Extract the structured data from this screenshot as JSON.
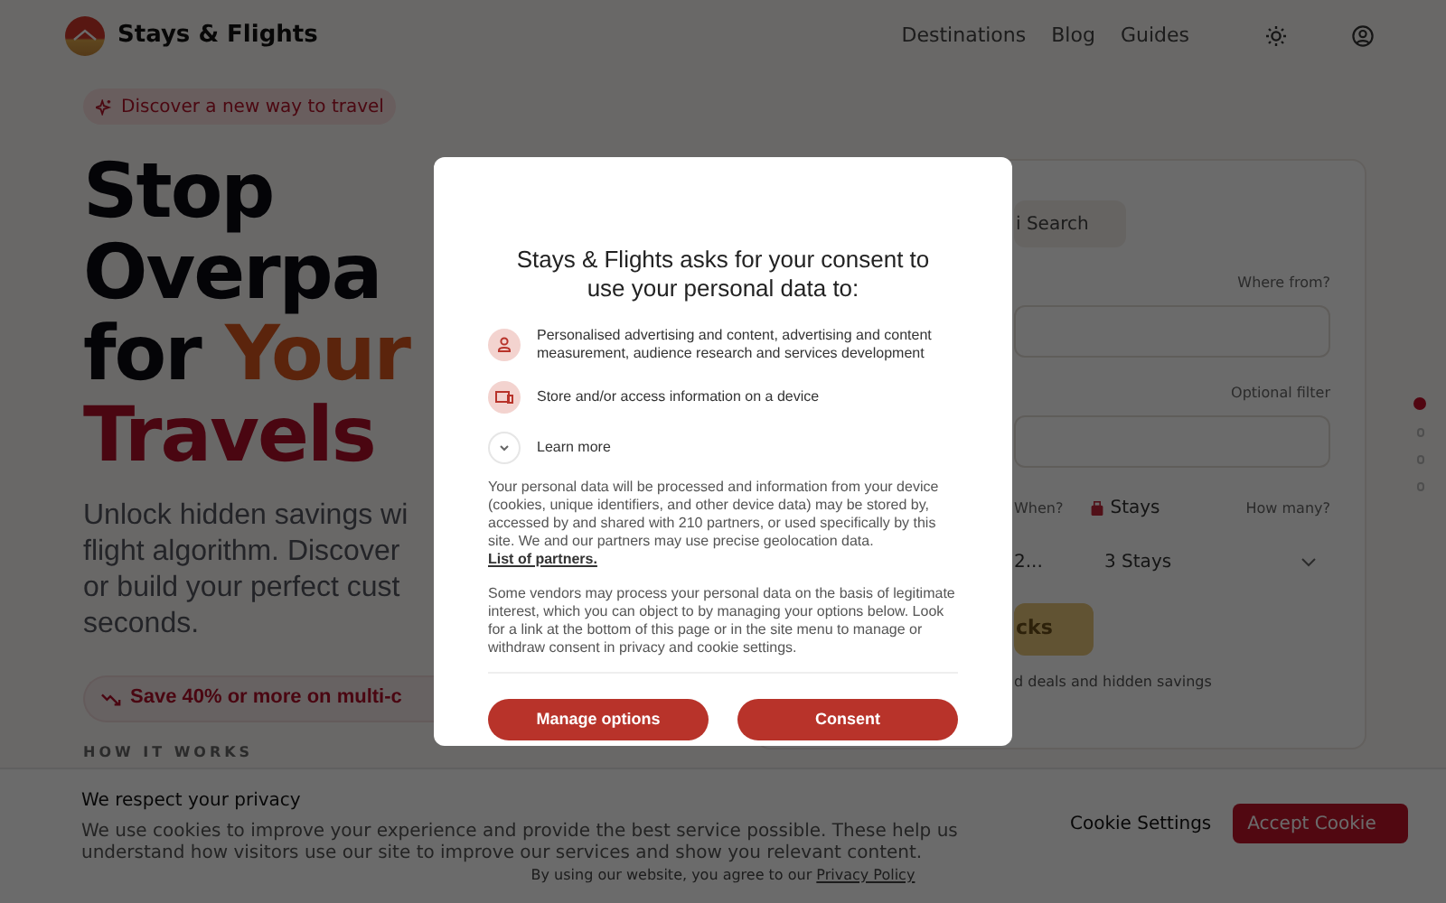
{
  "header": {
    "brand": "Stays & Flights",
    "nav": [
      {
        "label": "Destinations"
      },
      {
        "label": "Blog"
      },
      {
        "label": "Guides"
      }
    ]
  },
  "hero": {
    "badge": "Discover a new way to travel",
    "title_lines": [
      [
        {
          "text": "Stop",
          "kind": "plain"
        }
      ],
      [
        {
          "text": "Overpa",
          "kind": "plain"
        }
      ],
      [
        {
          "text": "for ",
          "kind": "plain"
        },
        {
          "text": "Your",
          "kind": "accent"
        }
      ],
      [
        {
          "text": "Travels",
          "kind": "strong_accent"
        }
      ]
    ],
    "subtitle": "Unlock hidden savings wi\nflight algorithm. Discover\nor build your perfect cust\nseconds.",
    "savings_pill": "Save 40% or more on multi-c",
    "section_label": "HOW IT WORKS"
  },
  "search_card": {
    "tab": "i Search",
    "from_label": "Where from?",
    "filter_label": "Optional filter",
    "when_label": "When?",
    "stays_label": "Stays",
    "how_many_label": "How many?",
    "date_value": "2...",
    "stays_value": "3 Stays",
    "button": "cks",
    "note": "d deals and hidden savings"
  },
  "section_dots": [
    {
      "selected": true
    },
    {
      "selected": false
    },
    {
      "selected": false
    },
    {
      "selected": false
    }
  ],
  "consent_dialog": {
    "title": "Stays & Flights asks for your consent to use your personal data to:",
    "purposes": [
      {
        "kind": "person",
        "text": "Personalised advertising and content, advertising and content measurement, audience research and services development"
      },
      {
        "kind": "device",
        "text": "Store and/or access information on a device"
      }
    ],
    "learn_more": "Learn more",
    "paragraph_1": "Your personal data will be processed and information from your device (cookies, unique identifiers, and other device data) may be stored by, accessed by and shared with 210 partners, or used specifically by this site. We and our partners may use precise geolocation data. ",
    "partners_link": "List of partners.",
    "paragraph_2": "Some vendors may process your personal data on the basis of legitimate interest, which you can object to by managing your options below. Look for a link at the bottom of this page or in the site menu to manage or withdraw consent in privacy and cookie settings.",
    "buttons": [
      {
        "label": "Manage options"
      },
      {
        "label": "Consent"
      }
    ]
  },
  "cookie_banner": {
    "title": "We respect your privacy",
    "text": "We use cookies to improve your experience and provide the best service possible. These help us understand how visitors use our site to improve our services and show you relevant content.",
    "buttons": [
      {
        "label": "Cookie Settings",
        "kind": "secondary"
      },
      {
        "label": "Accept Cookie",
        "kind": "primary"
      }
    ],
    "footer_text": "By using our website, you agree to our ",
    "footer_link": "Privacy Policy"
  }
}
